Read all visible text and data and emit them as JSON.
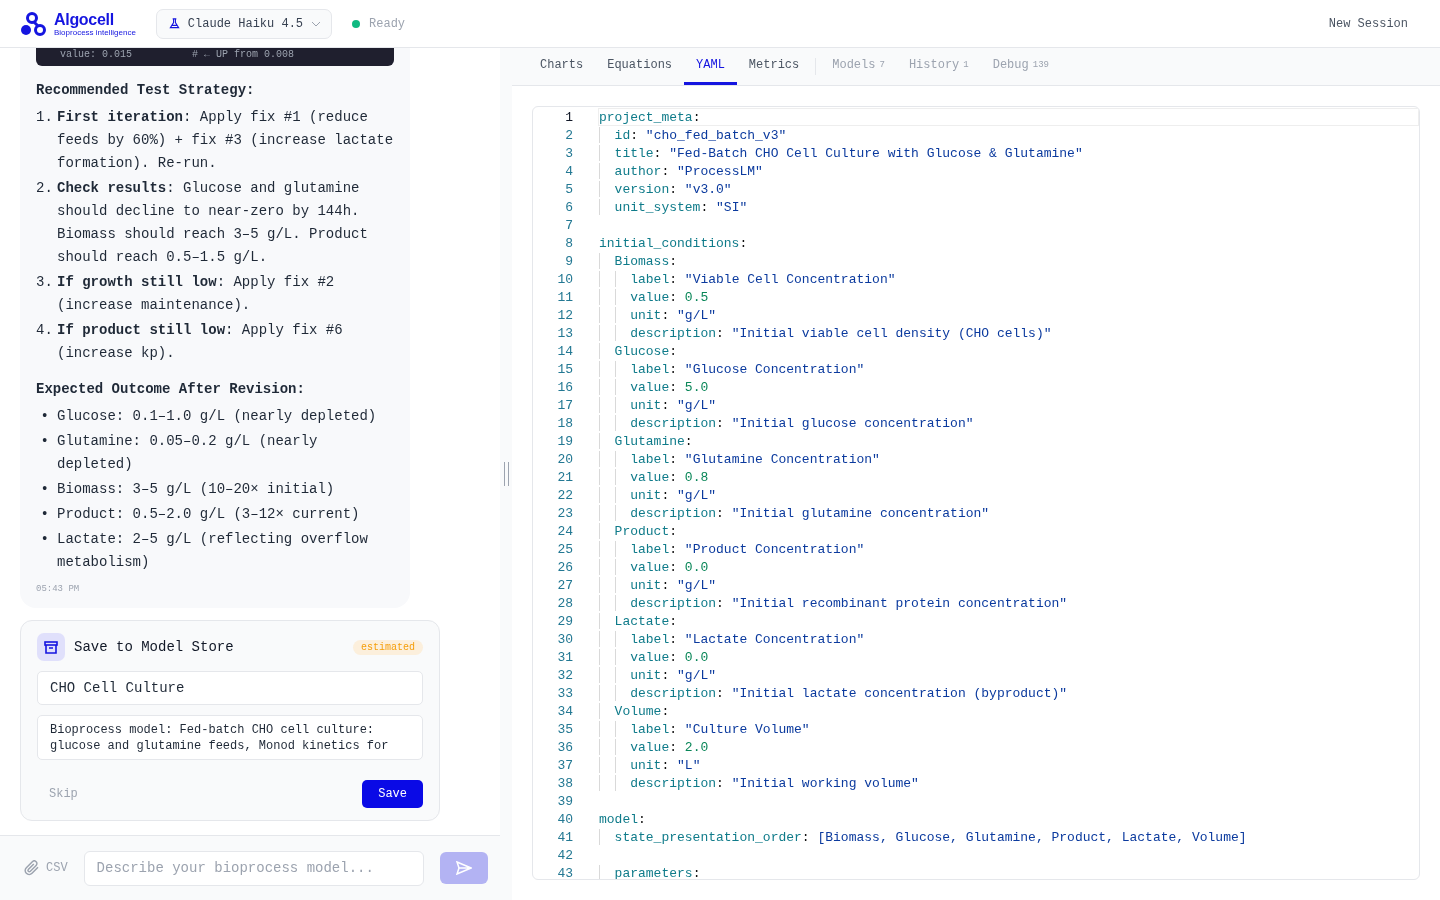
{
  "header": {
    "brand": "Algocell",
    "tagline": "Bioprocess intelligence",
    "model": "Claude Haiku 4.5",
    "status": {
      "label": "Ready",
      "color": "#10b981"
    },
    "new_session": "New Session"
  },
  "chat": {
    "code_lines": [
      {
        "code": "value: 0.015",
        "comment": "# ← UP from 0.008"
      }
    ],
    "blocks": [
      {
        "kind": "heading",
        "text": "Recommended Test Strategy:"
      },
      {
        "kind": "list",
        "items": [
          {
            "marker": "1.",
            "text": "**First iteration**: Apply fix #1 (reduce feeds by 60%) + fix #3 (increase lactate formation). Re-run."
          },
          {
            "marker": "2.",
            "text": "**Check results**: Glucose and glutamine should decline to near-zero by 144h. Biomass should reach 3–5 g/L. Product should reach 0.5–1.5 g/L."
          },
          {
            "marker": "3.",
            "text": "**If growth still low**: Apply fix #2 (increase maintenance)."
          },
          {
            "marker": "4.",
            "text": "**If product still low**: Apply fix #6 (increase kp)."
          }
        ]
      },
      {
        "kind": "heading",
        "text": "Expected Outcome After Revision:"
      },
      {
        "kind": "list",
        "items": [
          {
            "marker": "•",
            "text": "Glucose: 0.1–1.0 g/L (nearly depleted)"
          },
          {
            "marker": "•",
            "text": "Glutamine: 0.05–0.2 g/L (nearly depleted)"
          },
          {
            "marker": "•",
            "text": "Biomass: 3–5 g/L (10–20× initial)"
          },
          {
            "marker": "•",
            "text": "Product: 0.5–2.0 g/L (3–12× current)"
          },
          {
            "marker": "•",
            "text": "Lactate: 2–5 g/L (reflecting overflow metabolism)"
          }
        ]
      }
    ],
    "time": "05:43 PM"
  },
  "save_card": {
    "title": "Save to Model Store",
    "badge": "estimated",
    "name_value": "CHO Cell Culture",
    "description_lines": [
      "Bioprocess model: Fed-batch CHO cell culture:",
      "glucose and glutamine feeds, Monod kinetics for"
    ],
    "skip": "Skip",
    "save": "Save"
  },
  "composer": {
    "attach": "CSV",
    "placeholder": "Describe your bioprocess model...",
    "send_disabled": true
  },
  "tabs": [
    {
      "label": "Charts",
      "kind": "view",
      "selected": false
    },
    {
      "label": "Equations",
      "kind": "view",
      "selected": false
    },
    {
      "label": "YAML",
      "kind": "view",
      "selected": true
    },
    {
      "label": "Metrics",
      "kind": "view",
      "selected": false
    },
    {
      "label": "Models",
      "count": "7",
      "kind": "panel",
      "selected": false
    },
    {
      "label": "History",
      "count": "1",
      "kind": "panel",
      "selected": false
    },
    {
      "label": "Debug",
      "count": "139",
      "kind": "panel",
      "selected": false
    }
  ],
  "editor": {
    "lines": [
      {
        "n": "1",
        "key": "project_meta:",
        "current": true
      },
      {
        "n": "2",
        "key": "  id:",
        "value": "\"cho_fed_batch_v3\"",
        "kind": "string",
        "current": false
      },
      {
        "n": "3",
        "key": "  title:",
        "value": "\"Fed-Batch CHO Cell Culture with Glucose & Glutamine\"",
        "kind": "string",
        "current": false
      },
      {
        "n": "4",
        "key": "  author:",
        "value": "\"ProcessLM\"",
        "kind": "string",
        "current": false
      },
      {
        "n": "5",
        "key": "  version:",
        "value": "\"v3.0\"",
        "kind": "string",
        "current": false
      },
      {
        "n": "6",
        "key": "  unit_system:",
        "value": "\"SI\"",
        "kind": "string",
        "current": false
      },
      {
        "n": "7",
        "current": false
      },
      {
        "n": "8",
        "key": "initial_conditions:",
        "current": false
      },
      {
        "n": "9",
        "key": "  Biomass:",
        "current": false
      },
      {
        "n": "10",
        "key": "    label:",
        "value": "\"Viable Cell Concentration\"",
        "kind": "string",
        "current": false
      },
      {
        "n": "11",
        "key": "    value:",
        "value": "0.5",
        "kind": "number",
        "current": false
      },
      {
        "n": "12",
        "key": "    unit:",
        "value": "\"g/L\"",
        "kind": "string",
        "current": false
      },
      {
        "n": "13",
        "key": "    description:",
        "value": "\"Initial viable cell density (CHO cells)\"",
        "kind": "string",
        "current": false
      },
      {
        "n": "14",
        "key": "  Glucose:",
        "current": false
      },
      {
        "n": "15",
        "key": "    label:",
        "value": "\"Glucose Concentration\"",
        "kind": "string",
        "current": false
      },
      {
        "n": "16",
        "key": "    value:",
        "value": "5.0",
        "kind": "number",
        "current": false
      },
      {
        "n": "17",
        "key": "    unit:",
        "value": "\"g/L\"",
        "kind": "string",
        "current": false
      },
      {
        "n": "18",
        "key": "    description:",
        "value": "\"Initial glucose concentration\"",
        "kind": "string",
        "current": false
      },
      {
        "n": "19",
        "key": "  Glutamine:",
        "current": false
      },
      {
        "n": "20",
        "key": "    label:",
        "value": "\"Glutamine Concentration\"",
        "kind": "string",
        "current": false
      },
      {
        "n": "21",
        "key": "    value:",
        "value": "0.8",
        "kind": "number",
        "current": false
      },
      {
        "n": "22",
        "key": "    unit:",
        "value": "\"g/L\"",
        "kind": "string",
        "current": false
      },
      {
        "n": "23",
        "key": "    description:",
        "value": "\"Initial glutamine concentration\"",
        "kind": "string",
        "current": false
      },
      {
        "n": "24",
        "key": "  Product:",
        "current": false
      },
      {
        "n": "25",
        "key": "    label:",
        "value": "\"Product Concentration\"",
        "kind": "string",
        "current": false
      },
      {
        "n": "26",
        "key": "    value:",
        "value": "0.0",
        "kind": "number",
        "current": false
      },
      {
        "n": "27",
        "key": "    unit:",
        "value": "\"g/L\"",
        "kind": "string",
        "current": false
      },
      {
        "n": "28",
        "key": "    description:",
        "value": "\"Initial recombinant protein concentration\"",
        "kind": "string",
        "current": false
      },
      {
        "n": "29",
        "key": "  Lactate:",
        "current": false
      },
      {
        "n": "30",
        "key": "    label:",
        "value": "\"Lactate Concentration\"",
        "kind": "string",
        "current": false
      },
      {
        "n": "31",
        "key": "    value:",
        "value": "0.0",
        "kind": "number",
        "current": false
      },
      {
        "n": "32",
        "key": "    unit:",
        "value": "\"g/L\"",
        "kind": "string",
        "current": false
      },
      {
        "n": "33",
        "key": "    description:",
        "value": "\"Initial lactate concentration (byproduct)\"",
        "kind": "string",
        "current": false
      },
      {
        "n": "34",
        "key": "  Volume:",
        "current": false
      },
      {
        "n": "35",
        "key": "    label:",
        "value": "\"Culture Volume\"",
        "kind": "string",
        "current": false
      },
      {
        "n": "36",
        "key": "    value:",
        "value": "2.0",
        "kind": "number",
        "current": false
      },
      {
        "n": "37",
        "key": "    unit:",
        "value": "\"L\"",
        "kind": "string",
        "current": false
      },
      {
        "n": "38",
        "key": "    description:",
        "value": "\"Initial working volume\"",
        "kind": "string",
        "current": false
      },
      {
        "n": "39",
        "current": false
      },
      {
        "n": "40",
        "key": "model:",
        "current": false
      },
      {
        "n": "41",
        "key": "  state_presentation_order:",
        "value": "[Biomass, Glucose, Glutamine, Product, Lactate, Volume]",
        "kind": "list",
        "current": false
      },
      {
        "n": "42",
        "current": false
      },
      {
        "n": "43",
        "key": "  parameters:",
        "current": false
      }
    ]
  }
}
